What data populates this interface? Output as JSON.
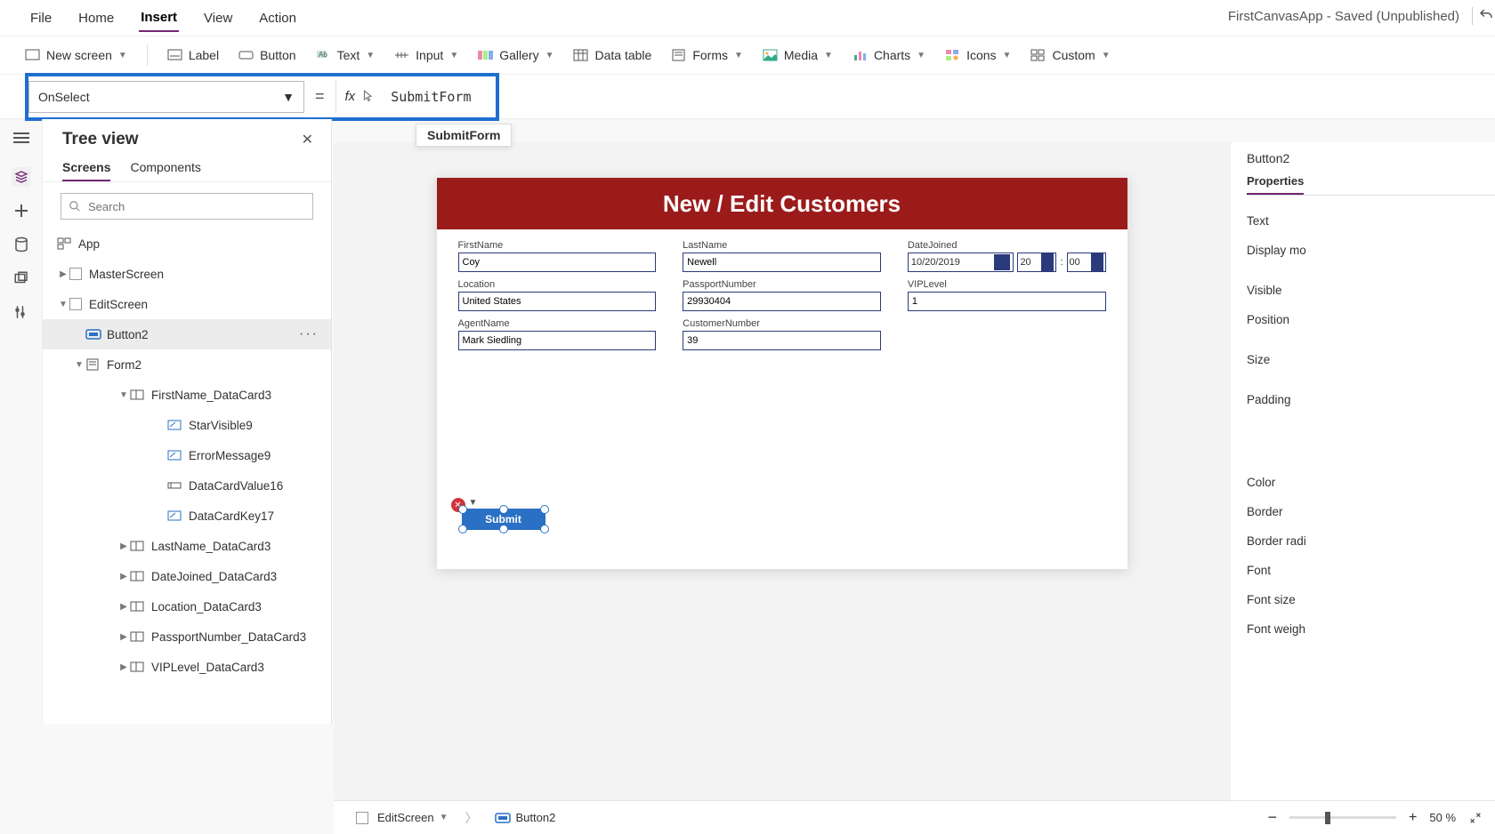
{
  "app_title": "FirstCanvasApp - Saved (Unpublished)",
  "menubar": {
    "file": "File",
    "home": "Home",
    "insert": "Insert",
    "view": "View",
    "action": "Action"
  },
  "ribbon": {
    "new_screen": "New screen",
    "label": "Label",
    "button": "Button",
    "text": "Text",
    "input": "Input",
    "gallery": "Gallery",
    "data_table": "Data table",
    "forms": "Forms",
    "media": "Media",
    "charts": "Charts",
    "icons": "Icons",
    "custom": "Custom"
  },
  "formula": {
    "property": "OnSelect",
    "equals": "=",
    "fx": "fx",
    "text": "SubmitForm"
  },
  "intellisense": "SubmitForm",
  "tree": {
    "title": "Tree view",
    "tabs": {
      "screens": "Screens",
      "components": "Components"
    },
    "search_placeholder": "Search",
    "items": {
      "app": "App",
      "master": "MasterScreen",
      "edit": "EditScreen",
      "button2": "Button2",
      "form2": "Form2",
      "firstname_dc": "FirstName_DataCard3",
      "starvisible": "StarVisible9",
      "errormsg": "ErrorMessage9",
      "dcvalue": "DataCardValue16",
      "dckey": "DataCardKey17",
      "lastname_dc": "LastName_DataCard3",
      "datejoined_dc": "DateJoined_DataCard3",
      "location_dc": "Location_DataCard3",
      "passport_dc": "PassportNumber_DataCard3",
      "vip_dc": "VIPLevel_DataCard3"
    }
  },
  "canvas": {
    "header": "New / Edit Customers",
    "fields": {
      "firstname_label": "FirstName",
      "firstname_value": "Coy",
      "lastname_label": "LastName",
      "lastname_value": "Newell",
      "datejoined_label": "DateJoined",
      "datejoined_value": "10/20/2019",
      "hour": "20",
      "minute": "00",
      "location_label": "Location",
      "location_value": "United States",
      "passport_label": "PassportNumber",
      "passport_value": "29930404",
      "vip_label": "VIPLevel",
      "vip_value": "1",
      "agent_label": "AgentName",
      "agent_value": "Mark Siedling",
      "custnum_label": "CustomerNumber",
      "custnum_value": "39"
    },
    "submit_btn": "Submit"
  },
  "props": {
    "selected": "Button2",
    "tab": "Properties",
    "rows": {
      "text": "Text",
      "display_mode": "Display mo",
      "visible": "Visible",
      "position": "Position",
      "size": "Size",
      "padding": "Padding",
      "color": "Color",
      "border": "Border",
      "border_radius": "Border radi",
      "font": "Font",
      "font_size": "Font size",
      "font_weight": "Font weigh"
    }
  },
  "statusbar": {
    "screen": "EditScreen",
    "control": "Button2",
    "zoom": "50",
    "pct": "%"
  }
}
